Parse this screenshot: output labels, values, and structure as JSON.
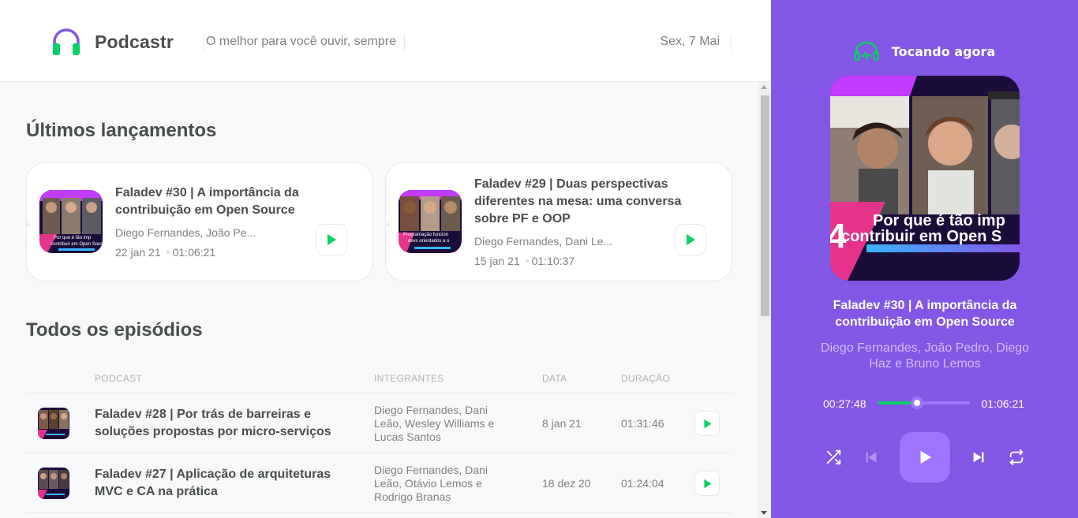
{
  "header": {
    "logo_text": "Podcastr",
    "tagline": "O melhor para você ouvir, sempre",
    "date": "Sex, 7 Mai"
  },
  "latest": {
    "title": "Últimos lançamentos",
    "episodes": [
      {
        "title": "Faladev #30 | A importância da contribuição em Open Source",
        "members": "Diego Fernandes, João Pe...",
        "date": "22 jan 21",
        "duration": "01:06:21",
        "thumb_text": "Por que é tão imp contribuir em Open Sour"
      },
      {
        "title": "Faladev #29 | Duas perspectivas diferentes na mesa: uma conversa sobre PF e OOP",
        "members": "Diego Fernandes, Dani Le...",
        "date": "15 jan 21",
        "duration": "01:10:37",
        "thumb_text": "Programação funcion devs orientados a o"
      }
    ]
  },
  "all": {
    "title": "Todos os episódios",
    "columns": {
      "podcast": "PODCAST",
      "members": "INTEGRANTES",
      "date": "DATA",
      "duration": "DURAÇÃO"
    },
    "rows": [
      {
        "title": "Faladev #28 | Por trás de barreiras e soluções propostas por micro-serviços",
        "members": "Diego Fernandes, Dani Leão, Wesley Williams e Lucas Santos",
        "date": "8 jan 21",
        "duration": "01:31:46"
      },
      {
        "title": "Faladev #27 | Aplicação de arquiteturas MVC e CA na prática",
        "members": "Diego Fernandes, Dani Leão, Otávio Lemos e Rodrigo Branas",
        "date": "18 dez 20",
        "duration": "01:24:04"
      }
    ]
  },
  "player": {
    "heading": "Tocando agora",
    "cover_text_1": "Por que é tão imp",
    "cover_text_2": "contribuir em Open S",
    "title": "Faladev #30 | A importância da contribuição em Open Source",
    "members": "Diego Fernandes, João Pedro, Diego Haz e Bruno Lemos",
    "current_time": "00:27:48",
    "total_time": "01:06:21",
    "progress": 0.42,
    "icons": [
      "headphone-icon",
      "shuffle-icon",
      "previous-icon",
      "play-icon",
      "next-icon",
      "repeat-icon"
    ]
  },
  "colors": {
    "purple": "#8257E5",
    "purple_light": "#9F75FF",
    "green": "#04D361",
    "text": "#494D4B",
    "muted": "#808080"
  }
}
